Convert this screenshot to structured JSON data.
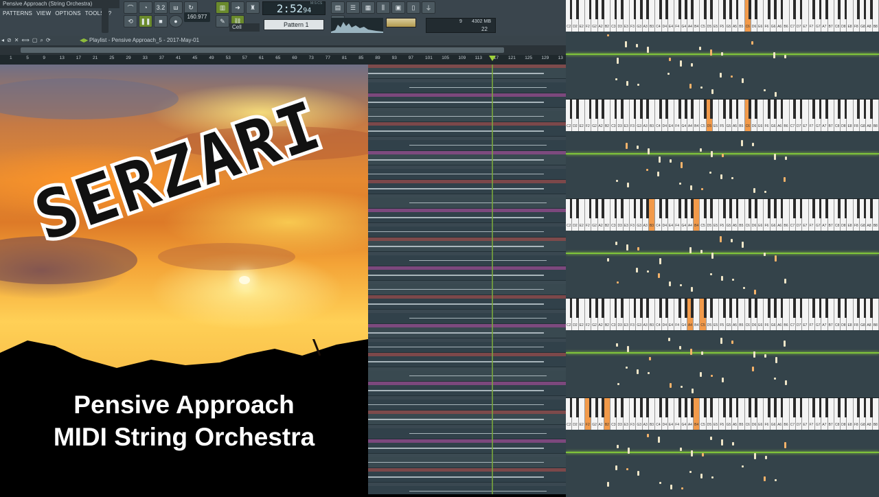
{
  "window": {
    "title": "Pensive Approach (String Orchestra)"
  },
  "menu": [
    "PATTERNS",
    "VIEW",
    "OPTIONS",
    "TOOLS",
    "?"
  ],
  "transport": {
    "time": "2:52",
    "time_sub": "94",
    "time_label": "M:S:CS",
    "tempo": "160.977",
    "pattern": "Pattern 1",
    "snap": "Cell",
    "cpu": "9",
    "ram": "4302 MB",
    "poly": "22",
    "misc_label": "3.2"
  },
  "playlist": {
    "title": "Playlist - Pensive Approach_5 - 2017-May-01",
    "ruler": [
      "1",
      "5",
      "9",
      "13",
      "17",
      "21",
      "25",
      "29",
      "33",
      "37",
      "41",
      "45",
      "49",
      "53",
      "57",
      "61",
      "65",
      "69",
      "73",
      "77",
      "81",
      "85",
      "89",
      "93",
      "97",
      "101",
      "105",
      "109",
      "113",
      "117",
      "121",
      "125",
      "129",
      "13"
    ]
  },
  "cover": {
    "brand": "SERZARI",
    "caption_line1": "Pensive Approach",
    "caption_line2": "MIDI String Orchestra"
  },
  "piano_labels": [
    "C2",
    "D2",
    "E2",
    "F2",
    "G2",
    "A2",
    "B2",
    "C3",
    "D3",
    "E3",
    "F3",
    "G3",
    "A3",
    "B3",
    "C4",
    "D4",
    "E4",
    "F4",
    "G4",
    "A4",
    "B4",
    "C5",
    "D5",
    "E5",
    "F5",
    "G5",
    "A5",
    "B5",
    "C6",
    "D6",
    "E6",
    "F6",
    "G6",
    "A6",
    "B6",
    "C7",
    "D7",
    "E7",
    "F7",
    "G7",
    "A7",
    "B7",
    "C8",
    "D8",
    "E8",
    "F8",
    "G8",
    "A8",
    "B8"
  ],
  "colors": {
    "accent": "#8fbd3b",
    "highlight_key": "#f29a4a",
    "grid": "#34434a"
  }
}
